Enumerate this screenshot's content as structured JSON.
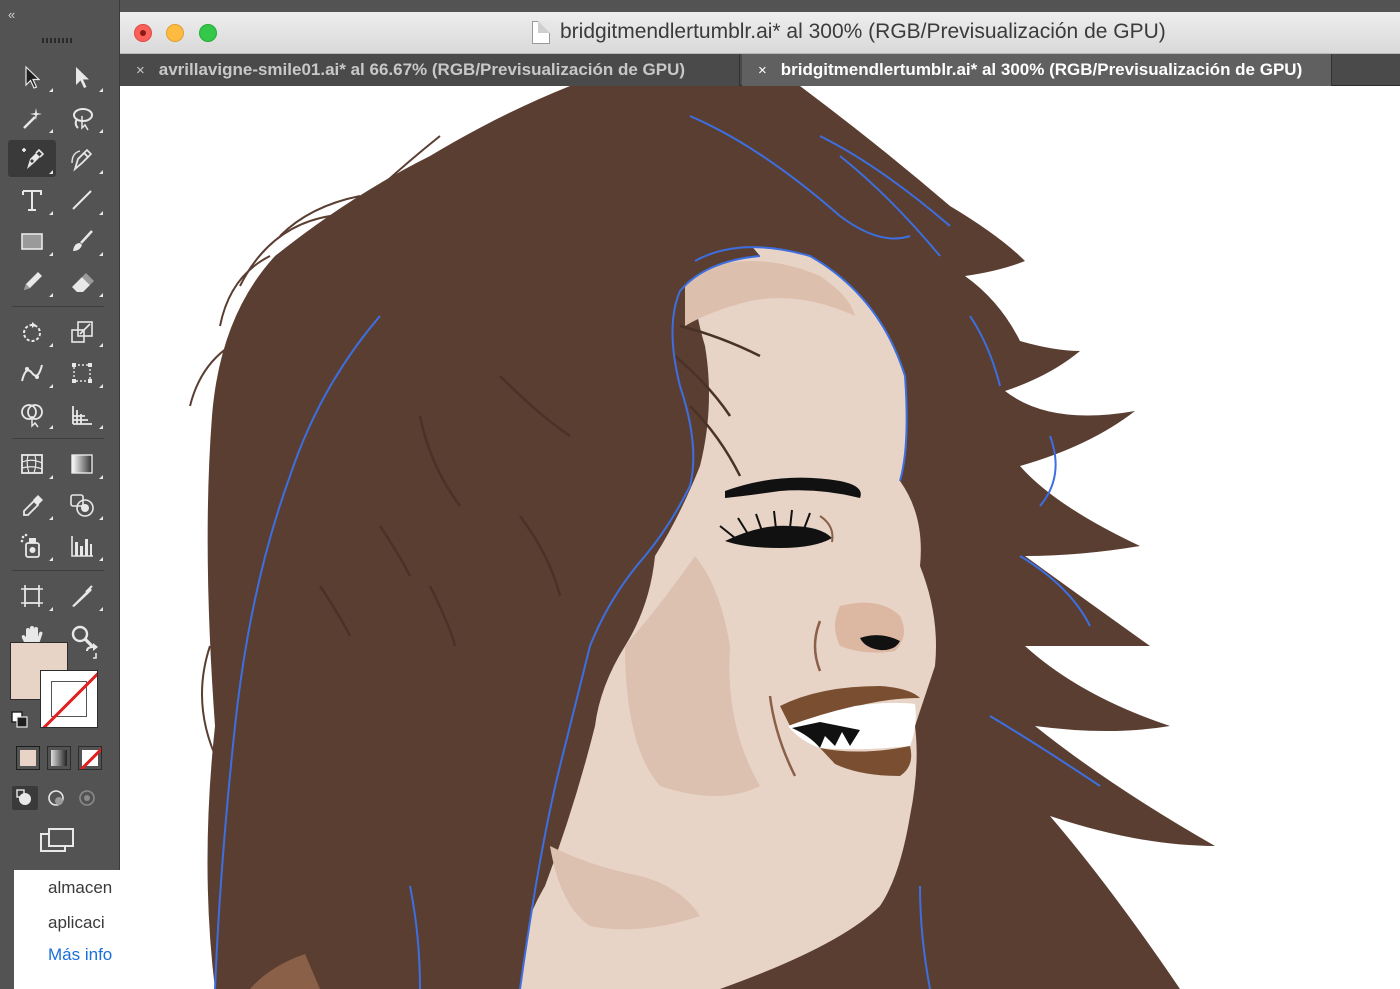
{
  "toolbar": {
    "collapse_label": "«",
    "tools": [
      "selection-tool",
      "direct-selection-tool",
      "magic-wand-tool",
      "lasso-tool",
      "pen-tool",
      "curvature-tool",
      "type-tool",
      "line-segment-tool",
      "rectangle-tool",
      "paintbrush-tool",
      "pencil-tool",
      "eraser-tool",
      "rotate-tool",
      "scale-tool",
      "puppet-warp-tool",
      "free-transform-tool",
      "shape-builder-tool",
      "perspective-grid-tool",
      "mesh-tool",
      "gradient-tool",
      "eyedropper-tool",
      "blend-tool",
      "symbol-sprayer-tool",
      "column-graph-tool",
      "artboard-tool",
      "slice-tool",
      "hand-tool",
      "zoom-tool"
    ],
    "active_tool": "pen-tool",
    "fill_color": "#e8d4c6",
    "stroke": "none"
  },
  "panel_fragment": {
    "line1": "almacen",
    "line2": "aplicaci",
    "line3": "Más info"
  },
  "window": {
    "title": "bridgitmendlertumblr.ai* al 300% (RGB/Previsualización de GPU)",
    "tabs": [
      {
        "label": "avrillavigne-smile01.ai* al 66.67% (RGB/Previsualización de GPU)",
        "active": false
      },
      {
        "label": "bridgitmendlertumblr.ai* al 300% (RGB/Previsualización de GPU)",
        "active": true
      }
    ],
    "close_glyph": "×"
  },
  "artwork": {
    "hair_color": "#5a3e31",
    "skin_color": "#e8d4c6",
    "skin_shadow": "#dcc0b0",
    "lip_color": "#7a4e30",
    "path_highlight": "#3d6fe0"
  }
}
